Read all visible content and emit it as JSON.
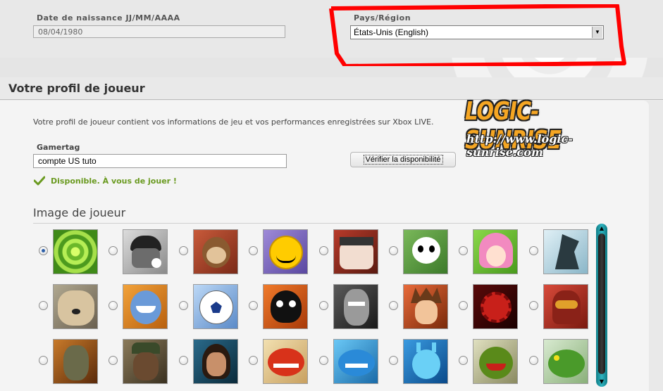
{
  "birth": {
    "label": "Date de naissance JJ/MM/AAAA",
    "value": "08/04/1980"
  },
  "country": {
    "label": "Pays/Région",
    "value": "États-Unis (English)"
  },
  "profile": {
    "title": "Votre profil de joueur",
    "description": "Votre profil de joueur contient vos informations de jeu et vos performances enregistrées sur Xbox LIVE.",
    "gamertag_label": "Gamertag",
    "gamertag_value": "compte US tuto",
    "check_button": "Vérifier la disponibilité",
    "availability": "Disponible. À vous de jouer !"
  },
  "watermark": {
    "name": "LOGIC-SUNRISE",
    "url": "http://www.logic-sunrise.com"
  },
  "gamerpics": {
    "title": "Image de joueur",
    "selected_index": 0,
    "items": [
      "green-rings",
      "beanie-guy",
      "monkey",
      "smiley",
      "pirate",
      "panda",
      "anime-girl",
      "dragon",
      "dog",
      "blue-creature",
      "soccer-ball",
      "skull",
      "cyber-warrior",
      "spiky-hair-boy",
      "red-skull-gear",
      "red-spartan",
      "soldier-fire",
      "soldier-portrait",
      "elf-girl",
      "red-dragon",
      "blue-fish",
      "blue-snail",
      "green-monster",
      "green-lizard"
    ]
  },
  "colors": {
    "accent_green": "#6a9a20",
    "highlight_red": "#ff0000",
    "scrollbar_teal": "#1e9ea8"
  }
}
